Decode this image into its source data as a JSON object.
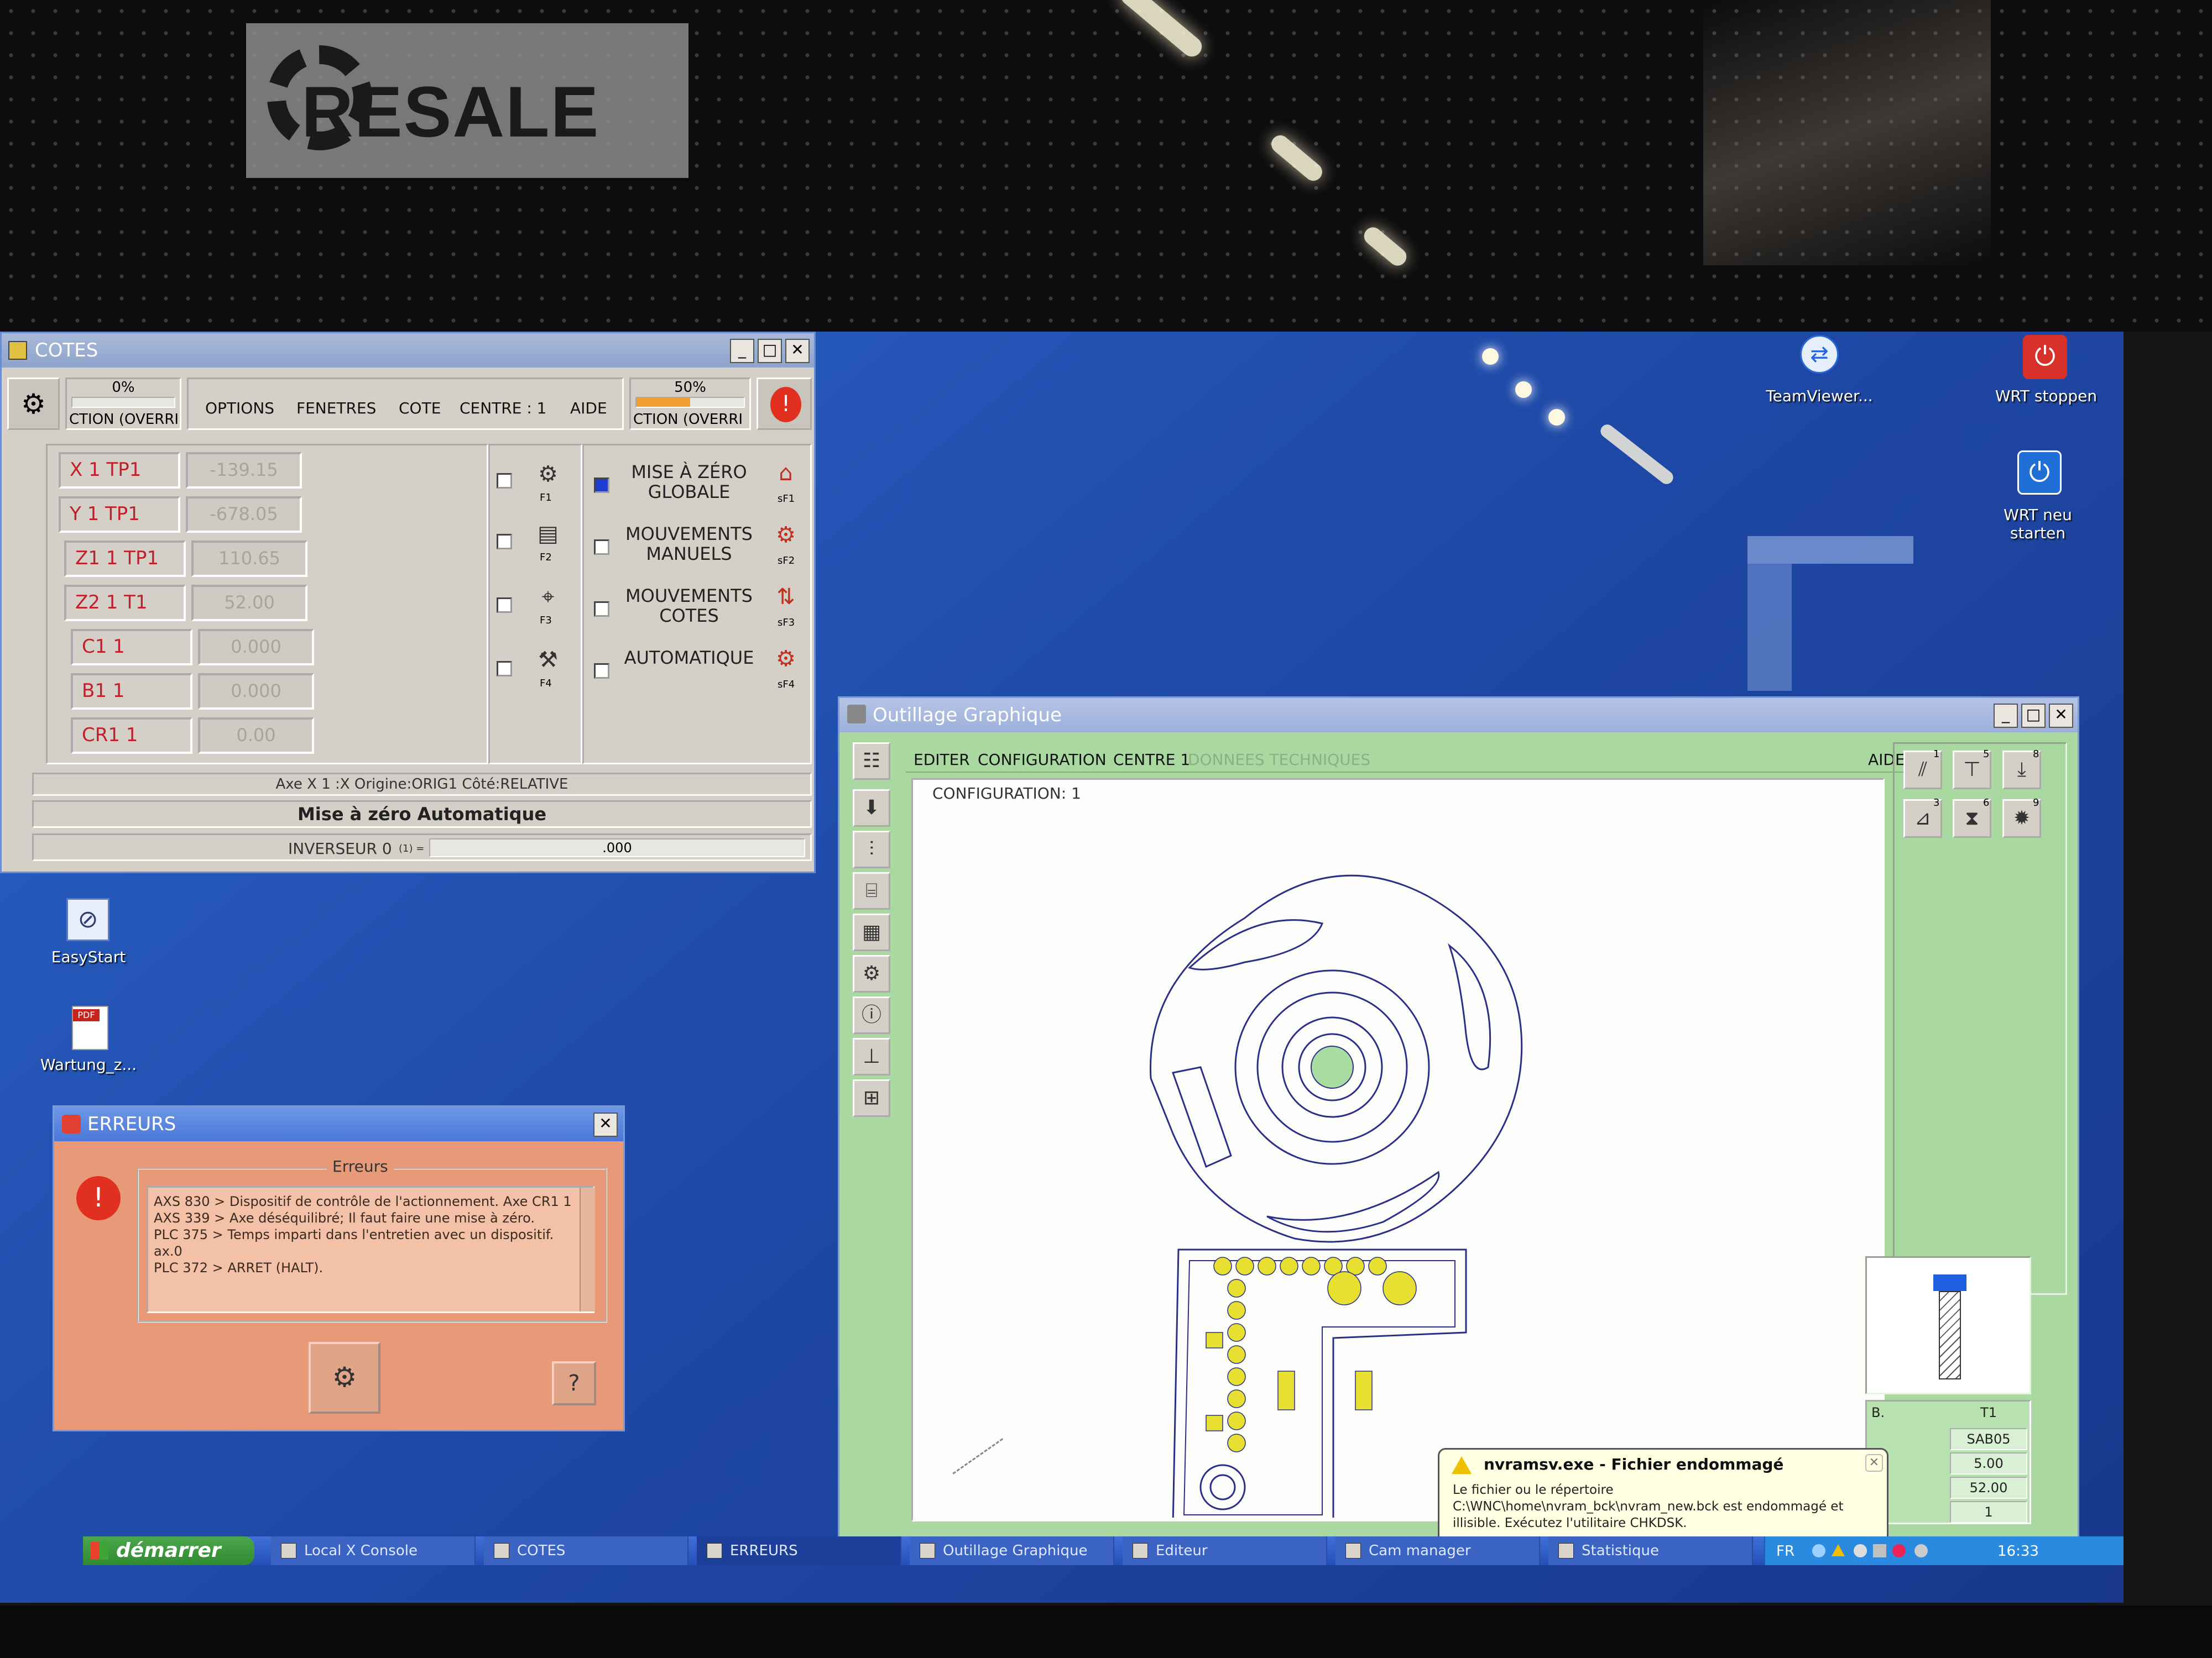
{
  "watermark": {
    "text": "RESALE"
  },
  "desktop": {
    "icons": [
      {
        "label": "TeamViewer..."
      },
      {
        "label": "WRT stoppen"
      },
      {
        "label": "WRT neu starten"
      },
      {
        "label": "EasyStart"
      },
      {
        "label": "Wartung_z..."
      }
    ]
  },
  "cotes": {
    "title": "COTES",
    "progress_left": {
      "percent_label": "0%",
      "value": 0,
      "caption": "CTION (OVERRI"
    },
    "progress_right": {
      "percent_label": "50%",
      "value": 0.5,
      "caption": "CTION (OVERRI"
    },
    "menu": [
      "OPTIONS",
      "FENETRES",
      "COTE",
      "CENTRE : 1",
      "AIDE"
    ],
    "axes": [
      {
        "label": "X  1  TP1",
        "value": "-139.15"
      },
      {
        "label": "Y  1  TP1",
        "value": "-678.05"
      },
      {
        "label": "Z1  1  TP1",
        "value": "110.65"
      },
      {
        "label": "Z2  1  T1",
        "value": "52.00"
      },
      {
        "label": "C1  1",
        "value": "0.000"
      },
      {
        "label": "B1  1",
        "value": "0.000"
      },
      {
        "label": "CR1  1",
        "value": "0.00"
      }
    ],
    "fkeys": [
      "F1",
      "F2",
      "F3",
      "F4"
    ],
    "modes": [
      {
        "label": "MISE À ZÉRO GLOBALE",
        "key": "sF1",
        "checked": true
      },
      {
        "label": "MOUVEMENTS MANUELS",
        "key": "sF2",
        "checked": false
      },
      {
        "label": "MOUVEMENTS COTES",
        "key": "sF3",
        "checked": false
      },
      {
        "label": "AUTOMATIQUE",
        "key": "sF4",
        "checked": false
      }
    ],
    "status_line": "Axe X 1 :X  Origine:ORIG1  Côté:RELATIVE",
    "status_mode": "Mise à zéro Automatique",
    "inverseur_label": "INVERSEUR 0",
    "inverseur_sub": "(1) =",
    "inverseur_value": ".000"
  },
  "erreurs": {
    "title": "ERREURS",
    "group_label": "Erreurs",
    "messages": [
      "AXS 830 >  Dispositif de contrôle de l'actionnement. Axe CR1 1",
      "AXS 339 >  Axe déséquilibré; Il faut faire une mise à zéro.",
      "PLC 375 >  Temps imparti dans l'entretien avec un dispositif.",
      "ax.0",
      "PLC 372 >  ARRET (HALT)."
    ]
  },
  "outillage": {
    "title": "Outillage Graphique",
    "menu": [
      "EDITER",
      "CONFIGURATION",
      "CENTRE 1",
      "DONNEES TECHNIQUES"
    ],
    "menu_right": "AIDE",
    "config_label": "CONFIGURATION: 1",
    "tool_numbers": [
      "1",
      "5",
      "8",
      "3",
      "6",
      "9"
    ],
    "table": {
      "headers": [
        "B.",
        "T1"
      ],
      "rows": [
        "SAB05",
        "5.00",
        "52.00",
        "1"
      ]
    }
  },
  "notification": {
    "title": "nvramsv.exe - Fichier endommagé",
    "body": "Le fichier ou le répertoire C:\\WNC\\home\\nvram_bck\\nvram_new.bck est endommagé et illisible. Exécutez l'utilitaire CHKDSK."
  },
  "taskbar": {
    "start_label": "démarrer",
    "tasks": [
      "Local X Console",
      "COTES",
      "ERREURS",
      "Outillage Graphique",
      "Editeur",
      "Cam manager",
      "Statistique"
    ],
    "lang": "FR",
    "clock": "16:33"
  },
  "colors": {
    "desktop": "#1f4aa8",
    "outillage_panel": "#a9d9a0",
    "error_panel": "#f0b49a",
    "axis_label": "#c0202a"
  }
}
